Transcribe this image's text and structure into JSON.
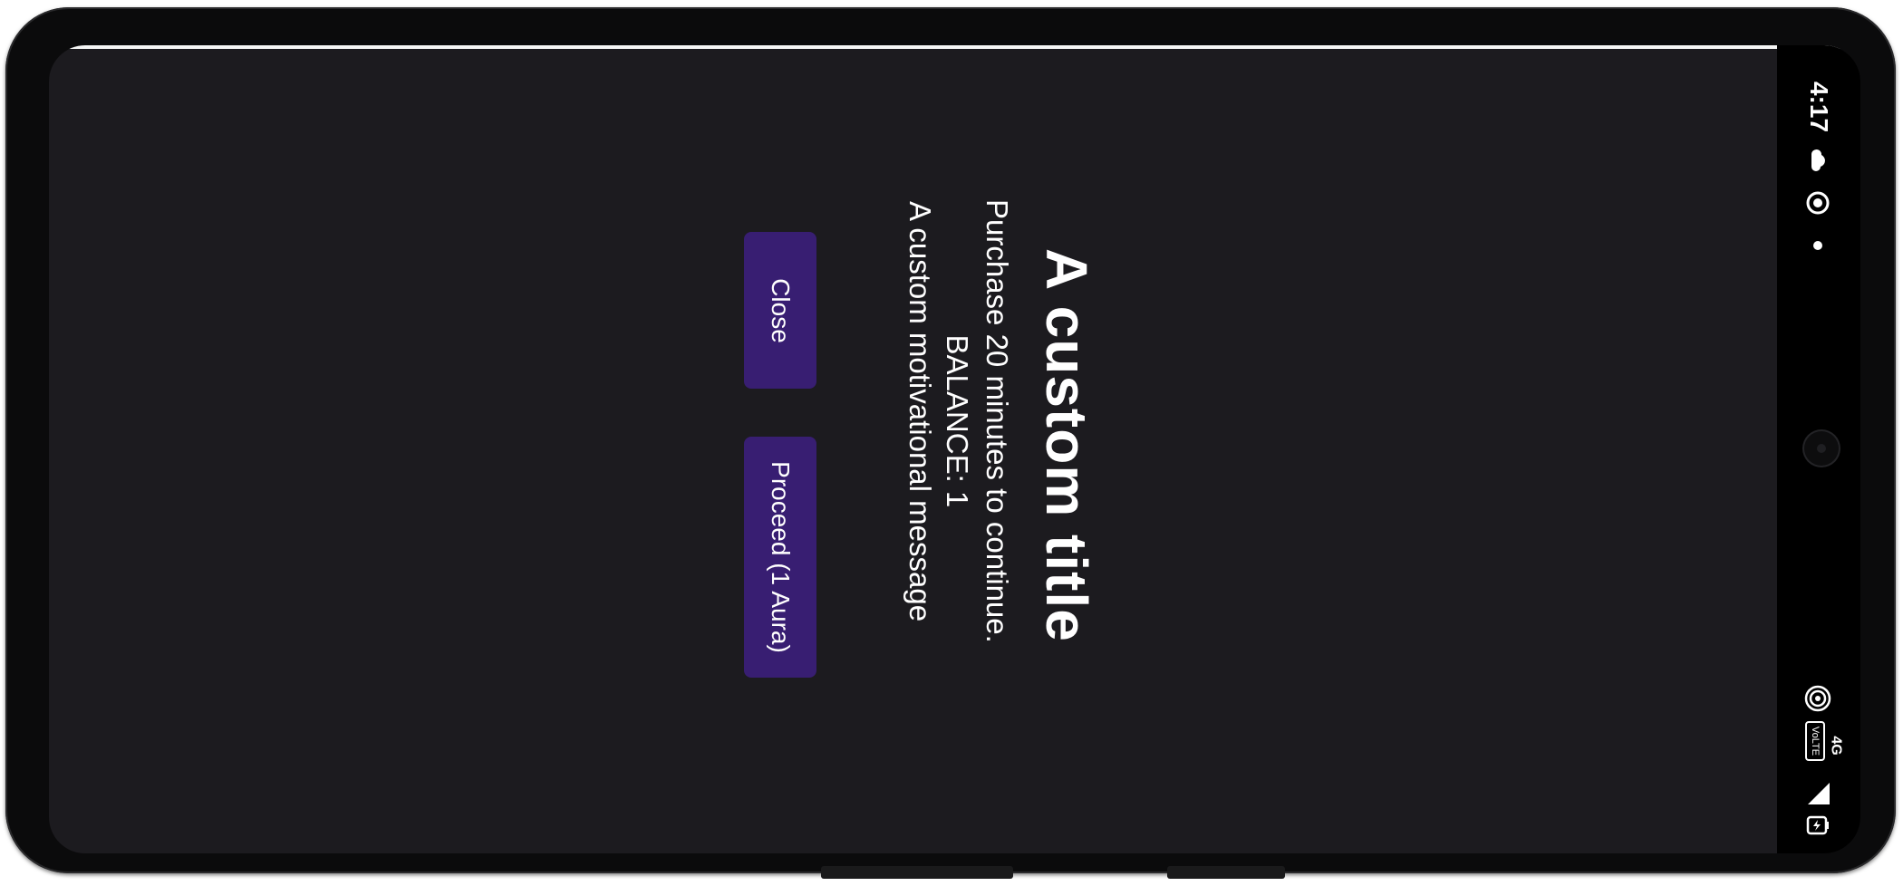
{
  "status_bar": {
    "time": "4:17",
    "network_label": "4G",
    "volte_label": "VoLTE"
  },
  "dialog": {
    "title": "A custom title",
    "purchase_text": "Purchase 20 minutes to continue.",
    "balance_text": "BALANCE: 1",
    "message": "A custom motivational message",
    "close_label": "Close",
    "proceed_label": "Proceed (1 Aura)"
  },
  "colors": {
    "background": "#1c1b1f",
    "button": "#381e72",
    "text": "#ffffff",
    "status_bar": "#000000"
  },
  "icons": [
    "cloud-icon",
    "sync-icon",
    "dot-icon",
    "hotspot-icon",
    "volte-icon",
    "signal-icon",
    "battery-charging-icon"
  ]
}
